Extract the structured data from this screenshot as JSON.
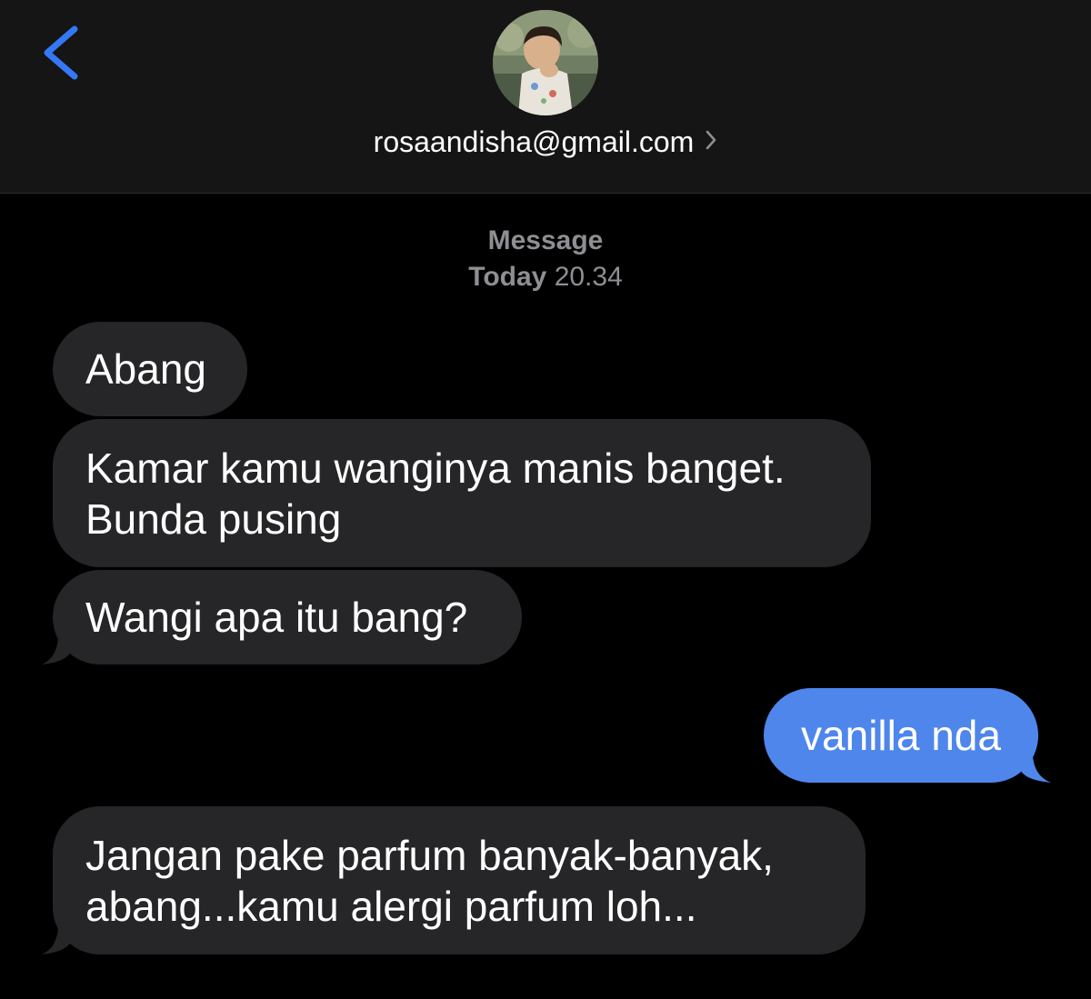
{
  "header": {
    "contact": "rosaandisha@gmail.com"
  },
  "thread": {
    "service": "Message",
    "day": "Today",
    "time": "20.34"
  },
  "messages": [
    {
      "from": "them",
      "text": "Abang"
    },
    {
      "from": "them",
      "lines": [
        "Kamar kamu wanginya manis banget.",
        "Bunda pusing"
      ]
    },
    {
      "from": "them",
      "text": "Wangi apa itu bang?"
    },
    {
      "from": "me",
      "text": "vanilla nda"
    },
    {
      "from": "them",
      "lines": [
        "Jangan pake parfum banyak-banyak,",
        "abang...kamu alergi parfum loh..."
      ]
    }
  ],
  "colors": {
    "background": "#000000",
    "header": "#151515",
    "received_bubble": "#262628",
    "sent_bubble": "#4f86ec",
    "accent": "#3478f6",
    "meta_text": "#8e8e93"
  },
  "icons": {
    "back": "chevron-left-icon",
    "contact_details": "chevron-right-icon"
  }
}
